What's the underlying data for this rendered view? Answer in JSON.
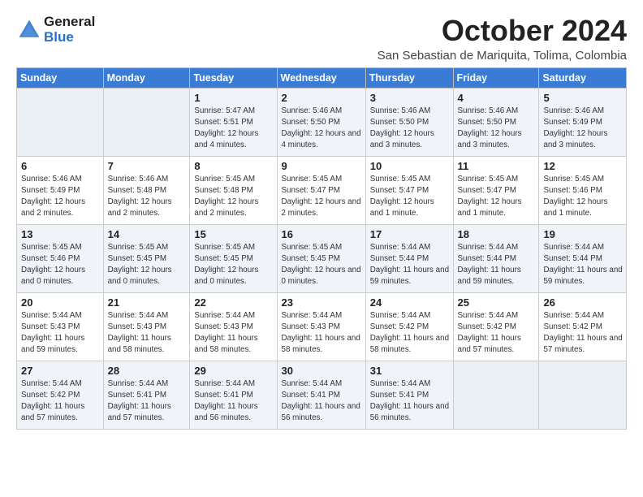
{
  "logo": {
    "general": "General",
    "blue": "Blue"
  },
  "header": {
    "title": "October 2024",
    "subtitle": "San Sebastian de Mariquita, Tolima, Colombia"
  },
  "weekdays": [
    "Sunday",
    "Monday",
    "Tuesday",
    "Wednesday",
    "Thursday",
    "Friday",
    "Saturday"
  ],
  "weeks": [
    [
      {
        "day": "",
        "empty": true
      },
      {
        "day": "",
        "empty": true
      },
      {
        "day": "1",
        "sunrise": "Sunrise: 5:47 AM",
        "sunset": "Sunset: 5:51 PM",
        "daylight": "Daylight: 12 hours and 4 minutes."
      },
      {
        "day": "2",
        "sunrise": "Sunrise: 5:46 AM",
        "sunset": "Sunset: 5:50 PM",
        "daylight": "Daylight: 12 hours and 4 minutes."
      },
      {
        "day": "3",
        "sunrise": "Sunrise: 5:46 AM",
        "sunset": "Sunset: 5:50 PM",
        "daylight": "Daylight: 12 hours and 3 minutes."
      },
      {
        "day": "4",
        "sunrise": "Sunrise: 5:46 AM",
        "sunset": "Sunset: 5:50 PM",
        "daylight": "Daylight: 12 hours and 3 minutes."
      },
      {
        "day": "5",
        "sunrise": "Sunrise: 5:46 AM",
        "sunset": "Sunset: 5:49 PM",
        "daylight": "Daylight: 12 hours and 3 minutes."
      }
    ],
    [
      {
        "day": "6",
        "sunrise": "Sunrise: 5:46 AM",
        "sunset": "Sunset: 5:49 PM",
        "daylight": "Daylight: 12 hours and 2 minutes."
      },
      {
        "day": "7",
        "sunrise": "Sunrise: 5:46 AM",
        "sunset": "Sunset: 5:48 PM",
        "daylight": "Daylight: 12 hours and 2 minutes."
      },
      {
        "day": "8",
        "sunrise": "Sunrise: 5:45 AM",
        "sunset": "Sunset: 5:48 PM",
        "daylight": "Daylight: 12 hours and 2 minutes."
      },
      {
        "day": "9",
        "sunrise": "Sunrise: 5:45 AM",
        "sunset": "Sunset: 5:47 PM",
        "daylight": "Daylight: 12 hours and 2 minutes."
      },
      {
        "day": "10",
        "sunrise": "Sunrise: 5:45 AM",
        "sunset": "Sunset: 5:47 PM",
        "daylight": "Daylight: 12 hours and 1 minute."
      },
      {
        "day": "11",
        "sunrise": "Sunrise: 5:45 AM",
        "sunset": "Sunset: 5:47 PM",
        "daylight": "Daylight: 12 hours and 1 minute."
      },
      {
        "day": "12",
        "sunrise": "Sunrise: 5:45 AM",
        "sunset": "Sunset: 5:46 PM",
        "daylight": "Daylight: 12 hours and 1 minute."
      }
    ],
    [
      {
        "day": "13",
        "sunrise": "Sunrise: 5:45 AM",
        "sunset": "Sunset: 5:46 PM",
        "daylight": "Daylight: 12 hours and 0 minutes."
      },
      {
        "day": "14",
        "sunrise": "Sunrise: 5:45 AM",
        "sunset": "Sunset: 5:45 PM",
        "daylight": "Daylight: 12 hours and 0 minutes."
      },
      {
        "day": "15",
        "sunrise": "Sunrise: 5:45 AM",
        "sunset": "Sunset: 5:45 PM",
        "daylight": "Daylight: 12 hours and 0 minutes."
      },
      {
        "day": "16",
        "sunrise": "Sunrise: 5:45 AM",
        "sunset": "Sunset: 5:45 PM",
        "daylight": "Daylight: 12 hours and 0 minutes."
      },
      {
        "day": "17",
        "sunrise": "Sunrise: 5:44 AM",
        "sunset": "Sunset: 5:44 PM",
        "daylight": "Daylight: 11 hours and 59 minutes."
      },
      {
        "day": "18",
        "sunrise": "Sunrise: 5:44 AM",
        "sunset": "Sunset: 5:44 PM",
        "daylight": "Daylight: 11 hours and 59 minutes."
      },
      {
        "day": "19",
        "sunrise": "Sunrise: 5:44 AM",
        "sunset": "Sunset: 5:44 PM",
        "daylight": "Daylight: 11 hours and 59 minutes."
      }
    ],
    [
      {
        "day": "20",
        "sunrise": "Sunrise: 5:44 AM",
        "sunset": "Sunset: 5:43 PM",
        "daylight": "Daylight: 11 hours and 59 minutes."
      },
      {
        "day": "21",
        "sunrise": "Sunrise: 5:44 AM",
        "sunset": "Sunset: 5:43 PM",
        "daylight": "Daylight: 11 hours and 58 minutes."
      },
      {
        "day": "22",
        "sunrise": "Sunrise: 5:44 AM",
        "sunset": "Sunset: 5:43 PM",
        "daylight": "Daylight: 11 hours and 58 minutes."
      },
      {
        "day": "23",
        "sunrise": "Sunrise: 5:44 AM",
        "sunset": "Sunset: 5:43 PM",
        "daylight": "Daylight: 11 hours and 58 minutes."
      },
      {
        "day": "24",
        "sunrise": "Sunrise: 5:44 AM",
        "sunset": "Sunset: 5:42 PM",
        "daylight": "Daylight: 11 hours and 58 minutes."
      },
      {
        "day": "25",
        "sunrise": "Sunrise: 5:44 AM",
        "sunset": "Sunset: 5:42 PM",
        "daylight": "Daylight: 11 hours and 57 minutes."
      },
      {
        "day": "26",
        "sunrise": "Sunrise: 5:44 AM",
        "sunset": "Sunset: 5:42 PM",
        "daylight": "Daylight: 11 hours and 57 minutes."
      }
    ],
    [
      {
        "day": "27",
        "sunrise": "Sunrise: 5:44 AM",
        "sunset": "Sunset: 5:42 PM",
        "daylight": "Daylight: 11 hours and 57 minutes."
      },
      {
        "day": "28",
        "sunrise": "Sunrise: 5:44 AM",
        "sunset": "Sunset: 5:41 PM",
        "daylight": "Daylight: 11 hours and 57 minutes."
      },
      {
        "day": "29",
        "sunrise": "Sunrise: 5:44 AM",
        "sunset": "Sunset: 5:41 PM",
        "daylight": "Daylight: 11 hours and 56 minutes."
      },
      {
        "day": "30",
        "sunrise": "Sunrise: 5:44 AM",
        "sunset": "Sunset: 5:41 PM",
        "daylight": "Daylight: 11 hours and 56 minutes."
      },
      {
        "day": "31",
        "sunrise": "Sunrise: 5:44 AM",
        "sunset": "Sunset: 5:41 PM",
        "daylight": "Daylight: 11 hours and 56 minutes."
      },
      {
        "day": "",
        "empty": true
      },
      {
        "day": "",
        "empty": true
      }
    ]
  ]
}
